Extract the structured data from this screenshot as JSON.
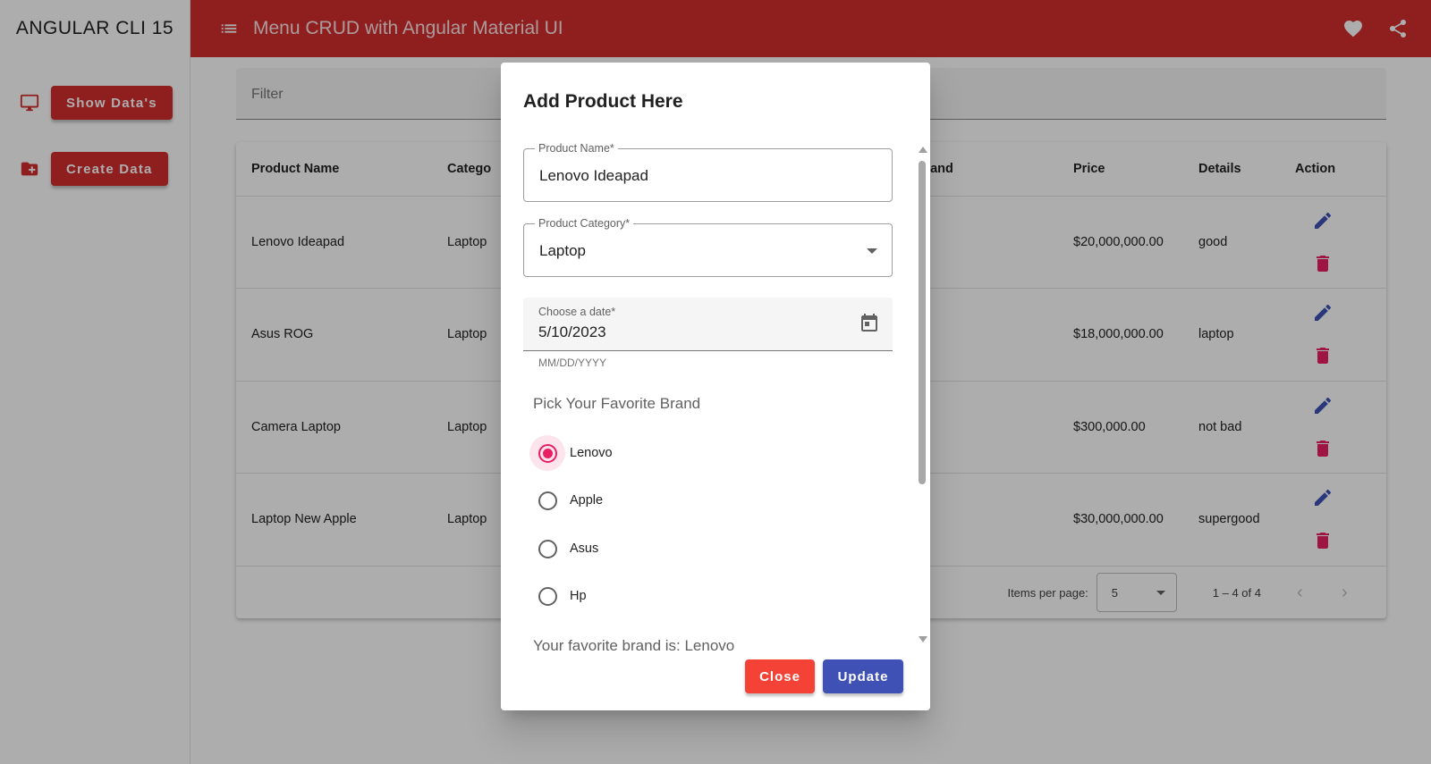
{
  "sidebar": {
    "brand": "ANGULAR CLI 15",
    "items": [
      {
        "label": "Show Data's",
        "icon": "monitor-icon"
      },
      {
        "label": "Create Data",
        "icon": "folder-add-icon"
      }
    ]
  },
  "toolbar": {
    "title": "Menu CRUD with Angular Material UI",
    "icons": [
      "menu-icon",
      "heart-icon",
      "share-icon"
    ]
  },
  "filter": {
    "placeholder": "Filter"
  },
  "table": {
    "columns": [
      "Product Name",
      "Category",
      "Brand",
      "Price",
      "Details",
      "Action"
    ],
    "visible_columns": [
      "Product Name",
      "Catego",
      "Brand",
      "Price",
      "Details",
      "Action"
    ],
    "rows": [
      {
        "name": "Lenovo Ideapad",
        "category": "Laptop",
        "price": "$20,000,000.00",
        "details": "good"
      },
      {
        "name": "Asus ROG",
        "category": "Laptop",
        "price": "$18,000,000.00",
        "details": "laptop"
      },
      {
        "name": "Camera Laptop",
        "category": "Laptop",
        "price": "$300,000.00",
        "details": "not bad"
      },
      {
        "name": "Laptop New Apple",
        "category": "Laptop",
        "price": "$30,000,000.00",
        "details": "supergood"
      }
    ]
  },
  "paginator": {
    "items_per_page_label": "Items per page:",
    "page_size": "5",
    "range": "1 – 4 of 4"
  },
  "dialog": {
    "title": "Add Product Here",
    "product_name": {
      "label": "Product Name*",
      "value": "Lenovo Ideapad"
    },
    "product_category": {
      "label": "Product Category*",
      "value": "Laptop"
    },
    "date": {
      "label": "Choose a date*",
      "value": "5/10/2023",
      "hint": "MM/DD/YYYY"
    },
    "brand_label": "Pick Your Favorite Brand",
    "brands": [
      "Lenovo",
      "Apple",
      "Asus",
      "Hp"
    ],
    "selected_brand": "Lenovo",
    "favorite_text": "Your favorite brand is: Lenovo",
    "close_label": "Close",
    "update_label": "Update"
  },
  "colors": {
    "primary": "#d32f2f",
    "accent": "#e91e63",
    "indigo": "#3f51b5",
    "close": "#f44336"
  }
}
